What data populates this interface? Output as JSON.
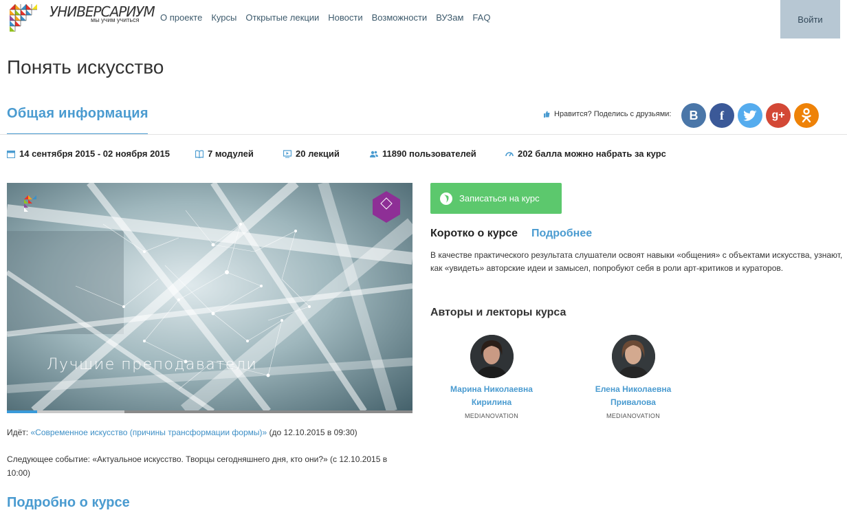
{
  "header": {
    "brand_name": "УНИВЕРСАРИУМ",
    "brand_tagline": "мы учим учиться",
    "nav": [
      "О проекте",
      "Курсы",
      "Открытые лекции",
      "Новости",
      "Возможности",
      "ВУЗам",
      "FAQ"
    ],
    "login_label": "Войти"
  },
  "page_title": "Понять искусство",
  "general_tab": "Общая информация",
  "share": {
    "label": "Нравится? Поделись с друзьями:",
    "networks": [
      {
        "glyph": "B",
        "color": "#4a76a8"
      },
      {
        "glyph": "f",
        "color": "#3b5998"
      },
      {
        "glyph": "t",
        "color": "#55acee"
      },
      {
        "glyph": "g+",
        "color": "#d34836"
      },
      {
        "glyph": "ok",
        "color": "#ee8208"
      }
    ]
  },
  "stats": {
    "dates": "14 сентября 2015 - 02 ноября 2015",
    "modules": "7 модулей",
    "lectures": "20 лекций",
    "users": "11890 пользователей",
    "points": "202 балла можно набрать за курс"
  },
  "video": {
    "caption": "Лучшие преподаватели",
    "badge_text": "MediaNovation",
    "progress_played": 0.075,
    "progress_buffer_start": 0.29
  },
  "going": {
    "prefix": "Идёт:",
    "link": "«Современное искусство (причины трансформации формы)»",
    "suffix": "(до 12.10.2015 в 09:30)"
  },
  "next_event": "Следующее событие: «Актуальное искусство. Творцы сегодняшнего дня, кто они?» (с 12.10.2015 в 10:00)",
  "details_heading": "Подробно о курсе",
  "enroll_label": "Записаться на курс",
  "about": {
    "tab_short": "Коротко о курсе",
    "tab_more": "Подробнее",
    "text": "В качестве практического результата слушатели освоят навыки «общения» с объектами искусства, узнают, как «увидеть» авторские идеи и замысел, попробуют себя в роли арт-критиков и кураторов."
  },
  "authors_title": "Авторы и лекторы курса",
  "authors": [
    {
      "name_1": "Марина Николаевна",
      "name_2": "Кирилина",
      "org": "MEDIANOVATION"
    },
    {
      "name_1": "Елена Николаевна",
      "name_2": "Привалова",
      "org": "MEDIANOVATION"
    }
  ]
}
